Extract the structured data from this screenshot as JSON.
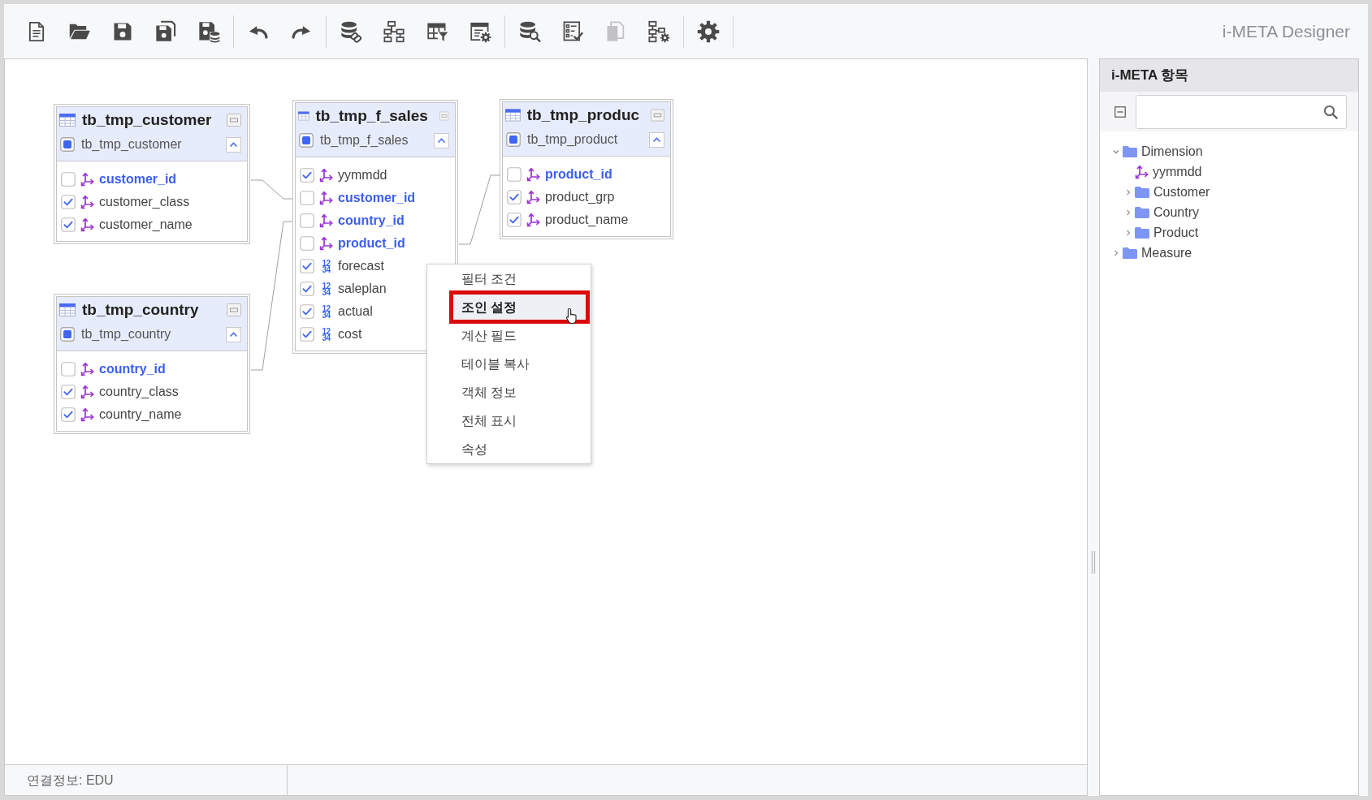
{
  "app": {
    "title": "i-META Designer"
  },
  "toolbar": {
    "groups": [
      [
        {
          "kind": "new",
          "disabled": false
        },
        {
          "kind": "open",
          "disabled": false
        },
        {
          "kind": "save",
          "disabled": false
        },
        {
          "kind": "save_as",
          "disabled": false
        },
        {
          "kind": "save_db",
          "disabled": false
        }
      ],
      [
        {
          "kind": "undo",
          "disabled": false
        },
        {
          "kind": "redo",
          "disabled": false
        }
      ],
      [
        {
          "kind": "db_link",
          "disabled": false
        },
        {
          "kind": "hierarchy",
          "disabled": false
        },
        {
          "kind": "table_filter",
          "disabled": false
        },
        {
          "kind": "window_gear",
          "disabled": false
        }
      ],
      [
        {
          "kind": "db_search",
          "disabled": false
        },
        {
          "kind": "checklist",
          "disabled": false
        },
        {
          "kind": "copy",
          "disabled": true
        },
        {
          "kind": "hierarchy_gear",
          "disabled": false
        }
      ],
      [
        {
          "kind": "settings",
          "disabled": false
        }
      ]
    ]
  },
  "tables": [
    {
      "title": "tb_tmp_customer",
      "name": "tb_tmp_customer",
      "indeterminate": true,
      "expanded": true,
      "columns": [
        {
          "name": "customer_id",
          "kind": "dimension",
          "key": true,
          "checked": false
        },
        {
          "name": "customer_class",
          "kind": "dimension",
          "key": false,
          "checked": true
        },
        {
          "name": "customer_name",
          "kind": "dimension",
          "key": false,
          "checked": true
        }
      ]
    },
    {
      "title": "tb_tmp_f_sales",
      "name": "tb_tmp_f_sales",
      "indeterminate": true,
      "expanded": true,
      "columns": [
        {
          "name": "yymmdd",
          "kind": "dimension",
          "key": false,
          "checked": true
        },
        {
          "name": "customer_id",
          "kind": "dimension",
          "key": true,
          "checked": false
        },
        {
          "name": "country_id",
          "kind": "dimension",
          "key": true,
          "checked": false
        },
        {
          "name": "product_id",
          "kind": "dimension",
          "key": true,
          "checked": false
        },
        {
          "name": "forecast",
          "kind": "measure",
          "type_label": [
            "12",
            "34"
          ],
          "key": false,
          "checked": true
        },
        {
          "name": "saleplan",
          "kind": "measure",
          "type_label": [
            "12",
            "34"
          ],
          "key": false,
          "checked": true
        },
        {
          "name": "actual",
          "kind": "measure",
          "type_label": [
            "12",
            "34"
          ],
          "key": false,
          "checked": true
        },
        {
          "name": "cost",
          "kind": "measure",
          "type_label": [
            "12",
            "34"
          ],
          "key": false,
          "checked": true
        }
      ]
    },
    {
      "title": "tb_tmp_produc",
      "name": "tb_tmp_product",
      "indeterminate": true,
      "expanded": true,
      "columns": [
        {
          "name": "product_id",
          "kind": "dimension",
          "key": true,
          "checked": false
        },
        {
          "name": "product_grp",
          "kind": "dimension",
          "key": false,
          "checked": true
        },
        {
          "name": "product_name",
          "kind": "dimension",
          "key": false,
          "checked": true
        }
      ]
    },
    {
      "title": "tb_tmp_country",
      "name": "tb_tmp_country",
      "indeterminate": true,
      "expanded": true,
      "columns": [
        {
          "name": "country_id",
          "kind": "dimension",
          "key": true,
          "checked": false
        },
        {
          "name": "country_class",
          "kind": "dimension",
          "key": false,
          "checked": true
        },
        {
          "name": "country_name",
          "kind": "dimension",
          "key": false,
          "checked": true
        }
      ]
    }
  ],
  "context_menu": {
    "items": [
      {
        "label": "필터 조건",
        "selected": false
      },
      {
        "label": "조인 설정",
        "selected": true
      },
      {
        "label": "계산 필드",
        "selected": false
      },
      {
        "label": "테이블 복사",
        "selected": false
      },
      {
        "label": "객체 정보",
        "selected": false
      },
      {
        "label": "전체 표시",
        "selected": false
      },
      {
        "label": "속성",
        "selected": false
      }
    ]
  },
  "side_panel": {
    "title": "i-META 항목",
    "tree": [
      {
        "label": "Dimension",
        "kind": "folder",
        "expanded": true,
        "children": [
          {
            "label": "yymmdd",
            "kind": "dimension"
          },
          {
            "label": "Customer",
            "kind": "folder",
            "expanded": false
          },
          {
            "label": "Country",
            "kind": "folder",
            "expanded": false
          },
          {
            "label": "Product",
            "kind": "folder",
            "expanded": false
          }
        ]
      },
      {
        "label": "Measure",
        "kind": "folder",
        "expanded": false
      }
    ]
  },
  "status_bar": {
    "connection": "연결정보: EDU"
  }
}
